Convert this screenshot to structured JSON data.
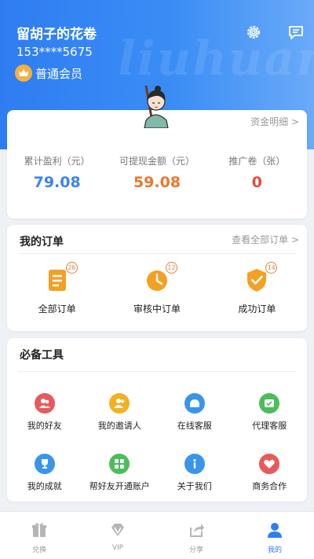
{
  "profile": {
    "name": "留胡子的花卷",
    "phone": "153****5675",
    "member_level": "普通会员",
    "watermark": "liuhuan"
  },
  "balance": {
    "detail_link": "资金明细 >",
    "stats": [
      {
        "label": "累计盈利（元）",
        "value": "79.08",
        "color": "#3c85e6"
      },
      {
        "label": "可提现金额（元）",
        "value": "59.08",
        "color": "#e8782f"
      },
      {
        "label": "推广卷（张）",
        "value": "0",
        "color": "#e24b3b"
      }
    ]
  },
  "orders": {
    "title": "我的订单",
    "view_all": "查看全部订单 >",
    "items": [
      {
        "label": "全部订单",
        "badge": "26",
        "icon": "list-icon"
      },
      {
        "label": "审核中订单",
        "badge": "12",
        "icon": "clock-icon"
      },
      {
        "label": "成功订单",
        "badge": "14",
        "icon": "shield-check-icon"
      }
    ]
  },
  "tools": {
    "title": "必备工具",
    "items": [
      {
        "label": "我的好友",
        "icon": "friends-icon",
        "color": "#e8595b"
      },
      {
        "label": "我的邀请人",
        "icon": "inviter-icon",
        "color": "#f2b123"
      },
      {
        "label": "在线客服",
        "icon": "chat-icon",
        "color": "#3a95e8"
      },
      {
        "label": "代理客服",
        "icon": "agent-icon",
        "color": "#4cbd5b"
      },
      {
        "label": "我的成就",
        "icon": "trophy-icon",
        "color": "#3a95e8"
      },
      {
        "label": "帮好友开通账户",
        "icon": "open-account-icon",
        "color": "#4cbd5b"
      },
      {
        "label": "关于我们",
        "icon": "info-icon",
        "color": "#3a95e8"
      },
      {
        "label": "商务合作",
        "icon": "handshake-icon",
        "color": "#e8595b"
      }
    ]
  },
  "tabbar": {
    "active": "我的",
    "items": [
      {
        "label": "兑换",
        "icon": "gift-icon"
      },
      {
        "label": "VIP",
        "icon": "diamond-icon"
      },
      {
        "label": "分享",
        "icon": "share-icon"
      },
      {
        "label": "我的",
        "icon": "user-icon"
      }
    ]
  },
  "colors": {
    "accent": "#2f7df2",
    "orange": "#f4a022",
    "header_gradient_end": "#6aaaf8"
  }
}
